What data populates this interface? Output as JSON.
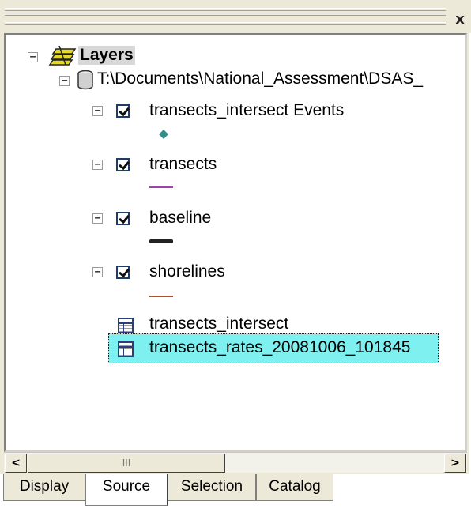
{
  "window": {
    "close_label": "x"
  },
  "tree": {
    "root": {
      "label": "Layers",
      "expander": "−"
    },
    "source": {
      "label": "T:\\Documents\\National_Assessment\\DSAS_",
      "expander": "−"
    },
    "layers": [
      {
        "label": "transects_intersect Events",
        "checked": true,
        "expander": "−",
        "symbol": "point",
        "color": "#2f8f8a"
      },
      {
        "label": "transects",
        "checked": true,
        "expander": "−",
        "symbol": "line",
        "color": "#a040b0"
      },
      {
        "label": "baseline",
        "checked": true,
        "expander": "−",
        "symbol": "thick-line",
        "color": "#222222"
      },
      {
        "label": "shorelines",
        "checked": true,
        "expander": "−",
        "symbol": "line",
        "color": "#b0502a"
      }
    ],
    "tables": [
      {
        "label": "transects_intersect",
        "icon": "table-icon"
      },
      {
        "label": "transects_rates_20081006_101845",
        "icon": "table-icon",
        "selected": true
      }
    ]
  },
  "scrollbar": {
    "left_arrow": "<",
    "right_arrow": ">",
    "thumb_grip": "III"
  },
  "tabs": [
    {
      "label": "Display",
      "active": false
    },
    {
      "label": "Source",
      "active": true
    },
    {
      "label": "Selection",
      "active": false
    },
    {
      "label": "Catalog",
      "active": false
    }
  ],
  "colors": {
    "selection": "#7ef0ef",
    "chrome": "#ece9d8"
  }
}
